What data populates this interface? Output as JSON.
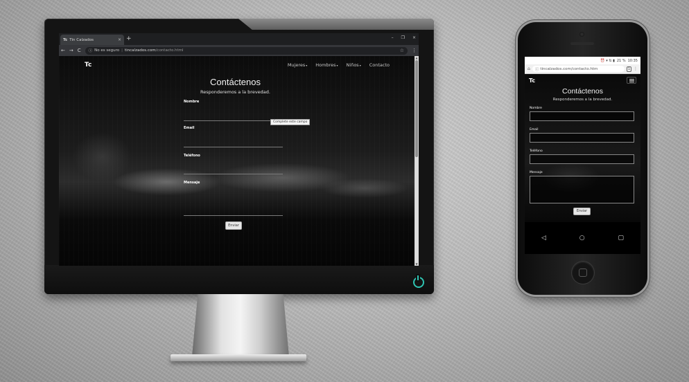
{
  "desktop": {
    "tab": {
      "favicon": "Tc",
      "title": "Tin Calzados",
      "close": "×",
      "new_tab": "+"
    },
    "window_controls": [
      "–",
      "❐",
      "×"
    ],
    "toolbar": {
      "back": "←",
      "forward": "→",
      "reload": "C",
      "security_icon": "ⓘ",
      "security_text": "No es seguro",
      "url_host": "tincalzados.com",
      "url_path": "/contacto.html",
      "star": "☆",
      "menu": "⋮"
    },
    "site": {
      "logo": "Tc",
      "nav": [
        "Mujeres",
        "Hombres",
        "Niños",
        "Contacto"
      ],
      "title": "Contáctenos",
      "subtitle": "Responderemos a la brevedad.",
      "fields": {
        "name": "Nombre",
        "email": "Email",
        "phone": "Teléfono",
        "message": "Mensaje"
      },
      "tooltip": "Complete este campo",
      "submit": "Enviar"
    }
  },
  "mobile": {
    "status": {
      "icons": "⏰ ▾ ⇅ ▮",
      "battery": "21 %",
      "time": "10:35"
    },
    "toolbar": {
      "home": "⌂",
      "security": "ⓘ",
      "url": "tincalzados.com/contacto.htm",
      "tabs": "1",
      "menu": "⋮"
    },
    "site": {
      "logo": "Tc",
      "title": "Contáctenos",
      "subtitle": "Responderemos a la brevedad.",
      "fields": {
        "name": "Nombre",
        "email": "Email",
        "phone": "Teléfono",
        "message": "Mensaje"
      },
      "submit": "Enviar"
    },
    "nav_buttons": {
      "back": "◁",
      "home": "○",
      "recent": "▢"
    }
  },
  "colors": {
    "power_accent": "#2fc4b2",
    "page_background": "#000000"
  }
}
